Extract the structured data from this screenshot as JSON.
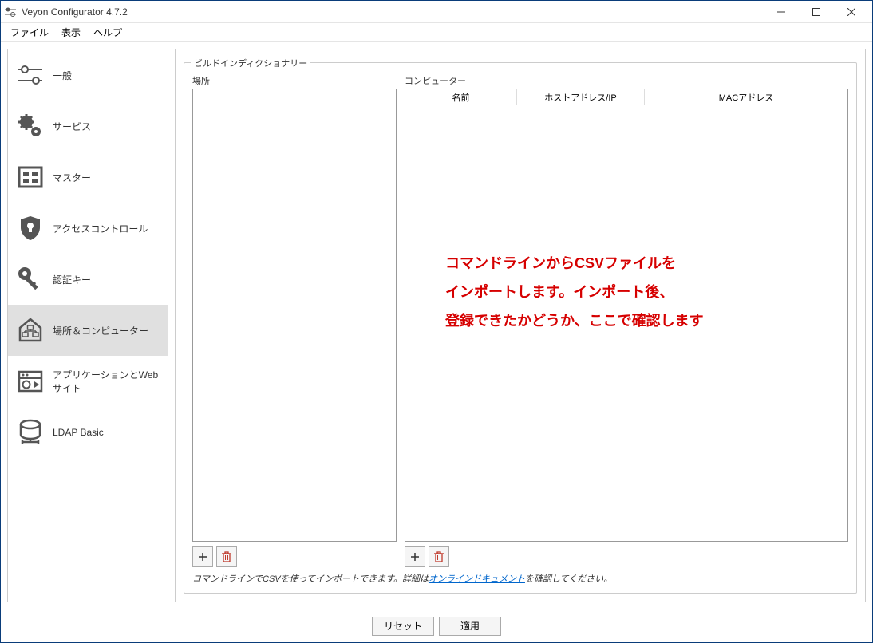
{
  "window": {
    "title": "Veyon Configurator 4.7.2"
  },
  "menu": {
    "file": "ファイル",
    "view": "表示",
    "help": "ヘルプ"
  },
  "sidebar": {
    "items": [
      {
        "label": "一般"
      },
      {
        "label": "サービス"
      },
      {
        "label": "マスター"
      },
      {
        "label": "アクセスコントロール"
      },
      {
        "label": "認証キー"
      },
      {
        "label": "場所＆コンピューター"
      },
      {
        "label": "アプリケーションとWebサイト"
      },
      {
        "label": "LDAP Basic"
      }
    ]
  },
  "content": {
    "groupbox_title": "ビルドインディクショナリー",
    "locations_label": "場所",
    "computers_label": "コンピューター",
    "table_headers": {
      "name": "名前",
      "host": "ホストアドレス/IP",
      "mac": "MACアドレス"
    },
    "hint_prefix": "コマンドラインでCSVを使ってインポートできます。詳細は",
    "hint_link": "オンラインドキュメント",
    "hint_suffix": "を確認してください。"
  },
  "overlay": {
    "text": "コマンドラインからCSVファイルを\nインポートします。インポート後、\n登録できたかどうか、ここで確認します"
  },
  "buttons": {
    "reset": "リセット",
    "apply": "適用"
  }
}
